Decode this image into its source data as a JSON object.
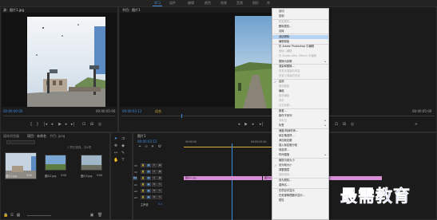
{
  "workspace_tabs": [
    "学习",
    "组件",
    "编辑",
    "颜色",
    "效果",
    "音频",
    "图形",
    "库"
  ],
  "source_panel": {
    "tab_label": "源：图片1.jpg",
    "timecode_left": "00:00:00:00",
    "timecode_right": "00:00:05:00"
  },
  "program_panel": {
    "tab_label": "节目：图片1",
    "timecode_left": "00:00:03:12",
    "fit_label": "适合",
    "timecode_right": "00:00:05:00"
  },
  "project_panel": {
    "tabs": [
      "媒体浏览器",
      "项目：未命名",
      "节目: jpeg"
    ],
    "search_placeholder": "",
    "item_count": "1 项已选择，共4项",
    "items": [
      {
        "name": "图片1.jpg",
        "duration": "5:00"
      },
      {
        "name": "图片2.jpg",
        "duration": "5:00"
      },
      {
        "name": "图片3.jpg",
        "duration": "5:00"
      }
    ]
  },
  "timeline_panel": {
    "sequence_tab": "图片1",
    "timecode": "00:00:03:12",
    "ruler_label_1": "00:00:00",
    "ruler_label_2": "00:00:05:00",
    "tracks": [
      {
        "name": "V3"
      },
      {
        "name": "V2"
      },
      {
        "name": "V1"
      },
      {
        "name": "A1"
      },
      {
        "name": "A2"
      },
      {
        "name": "A3"
      }
    ],
    "master_label": "主声道",
    "master_value": "0.0",
    "clips": [
      {
        "label": "图片1.jpg"
      },
      {
        "label": "图片2.jpg"
      }
    ]
  },
  "context_menu": {
    "items": [
      {
        "label": "剪切",
        "disabled": false
      },
      {
        "label": "复制",
        "disabled": false
      },
      {
        "label": "粘贴属性...",
        "disabled": true
      },
      {
        "label": "删除属性...",
        "disabled": false
      },
      {
        "label": "清除",
        "disabled": false
      },
      {
        "label": "波纹删除",
        "disabled": false,
        "highlighted": true
      },
      {
        "label": "编辑原始",
        "disabled": false
      },
      {
        "label": "在 Adobe Photoshop 中编辑",
        "disabled": false
      },
      {
        "label": "使用...编辑",
        "disabled": true
      },
      {
        "label": "在 Adobe After Effects 中编辑",
        "disabled": true
      },
      {
        "label": "替换为剪辑",
        "disabled": false,
        "submenu": true
      },
      {
        "label": "渲染和替换...",
        "disabled": false
      },
      {
        "label": "恢复未渲染的内容",
        "disabled": true
      },
      {
        "label": "恢复已渲染的内容",
        "disabled": true
      },
      {
        "label": "启用",
        "disabled": false,
        "checked": true
      },
      {
        "label": "取消链接",
        "disabled": true
      },
      {
        "label": "编组",
        "disabled": false
      },
      {
        "label": "取消编组",
        "disabled": true
      },
      {
        "label": "同步",
        "disabled": true
      },
      {
        "label": "合并剪辑...",
        "disabled": true
      },
      {
        "label": "嵌套...",
        "disabled": false
      },
      {
        "label": "制作子序列",
        "disabled": false
      },
      {
        "label": "多机位",
        "disabled": true,
        "submenu": true
      },
      {
        "label": "标签",
        "disabled": false,
        "submenu": true
      },
      {
        "label": "速度/持续时间...",
        "disabled": false
      },
      {
        "label": "帧定格选项...",
        "disabled": false
      },
      {
        "label": "添加帧定格",
        "disabled": false
      },
      {
        "label": "插入帧定格分段",
        "disabled": false
      },
      {
        "label": "场选项...",
        "disabled": false
      },
      {
        "label": "时间插值",
        "disabled": false,
        "submenu": true
      },
      {
        "label": "缩放为帧大小",
        "disabled": false
      },
      {
        "label": "设为帧大小",
        "disabled": false,
        "checked": true
      },
      {
        "label": "调整图层",
        "disabled": false
      },
      {
        "label": "链接媒体...",
        "disabled": true
      },
      {
        "label": "设为脱机...",
        "disabled": false
      },
      {
        "label": "重命名...",
        "disabled": false
      },
      {
        "label": "在项目中显示",
        "disabled": false
      },
      {
        "label": "在资源管理器中显示...",
        "disabled": false
      },
      {
        "label": "属性",
        "disabled": false
      }
    ]
  },
  "watermark": "最需教育",
  "colors": {
    "accent": "#3b8be0",
    "clip": "#d88fd6",
    "menu_highlight": "#b6d3f2",
    "watermark": "#1f4fd4"
  }
}
